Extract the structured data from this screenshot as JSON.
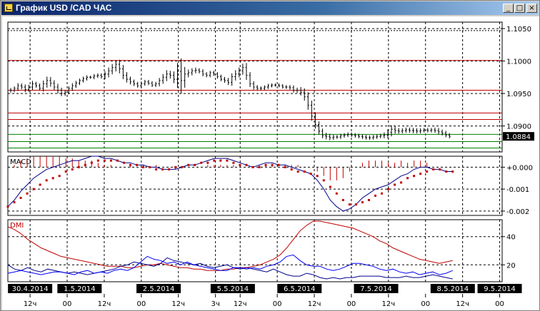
{
  "window": {
    "title": "График USD /CAD  ЧАС",
    "app_icon": "chart-app-icon",
    "controls": {
      "minimize": "_",
      "maximize": "□",
      "close": "×"
    }
  },
  "colors": {
    "price_bar": "#000000",
    "resistance_line": "#c00000",
    "support_line": "#008000",
    "macd_line": "#00008b",
    "macd_signal": "#c00000",
    "macd_hist": "#c00000",
    "dmi_adx": "#c00000",
    "dmi_plus": "#00008b",
    "dmi_minus": "#0000ff",
    "last_price_bg": "#000000",
    "last_price_fg": "#ffffff"
  },
  "chart_data": [
    {
      "type": "ohlc",
      "title": "",
      "ylim": [
        1.086,
        1.106
      ],
      "y_ticks": [
        "1.1050",
        "1.1000",
        "1.0950",
        "1.0900"
      ],
      "y_tick_values": [
        1.105,
        1.1,
        1.095,
        1.09
      ],
      "last_price": "1.0884",
      "last_price_value": 1.0884,
      "horizontal_lines": [
        {
          "value": 1.1047,
          "style": "dotted",
          "color": "black"
        },
        {
          "value": 1.1001,
          "style": "solid",
          "color": "red"
        },
        {
          "value": 1.0955,
          "style": "solid",
          "color": "red"
        },
        {
          "value": 1.092,
          "style": "solid",
          "color": "red"
        },
        {
          "value": 1.091,
          "style": "solid",
          "color": "red"
        },
        {
          "value": 1.0887,
          "style": "solid",
          "color": "green"
        },
        {
          "value": 1.0876,
          "style": "solid",
          "color": "green"
        },
        {
          "value": 1.0866,
          "style": "solid",
          "color": "green"
        }
      ],
      "close": [
        1.0955,
        1.0958,
        1.0962,
        1.096,
        1.0956,
        1.096,
        1.0965,
        1.0962,
        1.0958,
        1.0965,
        1.097,
        1.0966,
        1.096,
        1.0955,
        1.095,
        1.0952,
        1.0958,
        1.0962,
        1.0966,
        1.097,
        1.0973,
        1.0975,
        1.0975,
        1.0977,
        1.0978,
        1.0976,
        1.098,
        1.0985,
        1.099,
        1.0995,
        1.0988,
        1.0978,
        1.0972,
        1.0968,
        1.0965,
        1.0962,
        1.0965,
        1.0968,
        1.0966,
        1.0963,
        1.0965,
        1.097,
        1.0975,
        1.098,
        1.0978,
        1.0972,
        1.0984,
        1.097,
        1.098,
        1.0982,
        1.0985,
        1.0986,
        1.0984,
        1.098,
        1.0978,
        1.0982,
        1.098,
        1.0976,
        1.0972,
        1.097,
        1.0967,
        1.0976,
        1.098,
        1.0985,
        1.099,
        1.0978,
        1.0965,
        1.096,
        1.0958,
        1.0958,
        1.096,
        1.0962,
        1.0963,
        1.0963,
        1.0962,
        1.096,
        1.096,
        1.0959,
        1.0955,
        1.0955,
        1.0952,
        1.0945,
        1.0932,
        1.0915,
        1.0902,
        1.0892,
        1.0885,
        1.0884,
        1.0882,
        1.0883,
        1.0883,
        1.0885,
        1.0886,
        1.0887,
        1.0886,
        1.0885,
        1.0884,
        1.0883,
        1.0882,
        1.0882,
        1.0883,
        1.0884,
        1.0885,
        1.0886,
        1.089,
        1.0895,
        1.0893,
        1.0892,
        1.0893,
        1.0894,
        1.0893,
        1.0893,
        1.0892,
        1.0893,
        1.0894,
        1.0893,
        1.0894,
        1.0893,
        1.0891,
        1.0889,
        1.0886,
        1.0884
      ],
      "range": [
        0.0007,
        0.0006,
        0.0008,
        0.0007,
        0.0008,
        0.0007,
        0.0009,
        0.0006,
        0.0007,
        0.001,
        0.0012,
        0.0011,
        0.0009,
        0.001,
        0.0008,
        0.0007,
        0.0006,
        0.0008,
        0.0007,
        0.0006,
        0.0006,
        0.0006,
        0.0005,
        0.0006,
        0.0006,
        0.0006,
        0.0008,
        0.001,
        0.0011,
        0.0012,
        0.0014,
        0.0012,
        0.001,
        0.0008,
        0.0007,
        0.0006,
        0.0007,
        0.0006,
        0.0006,
        0.0006,
        0.0006,
        0.0008,
        0.001,
        0.0012,
        0.001,
        0.0012,
        0.0026,
        0.004,
        0.0022,
        0.001,
        0.0008,
        0.0008,
        0.0006,
        0.0007,
        0.0006,
        0.0006,
        0.0006,
        0.0006,
        0.0006,
        0.0007,
        0.0008,
        0.001,
        0.0012,
        0.001,
        0.0012,
        0.0014,
        0.001,
        0.0008,
        0.0006,
        0.0006,
        0.0005,
        0.0006,
        0.0005,
        0.0005,
        0.0005,
        0.0005,
        0.0006,
        0.0006,
        0.0007,
        0.0008,
        0.001,
        0.0012,
        0.0014,
        0.0014,
        0.0012,
        0.001,
        0.0008,
        0.0009,
        0.0008,
        0.0007,
        0.0006,
        0.0006,
        0.0006,
        0.0006,
        0.0006,
        0.0006,
        0.0006,
        0.0006,
        0.0006,
        0.0007,
        0.0006,
        0.0006,
        0.0006,
        0.0008,
        0.001,
        0.0012,
        0.001,
        0.0008,
        0.0007,
        0.0007,
        0.0007,
        0.0008,
        0.0007,
        0.0007,
        0.0006,
        0.0006,
        0.0006,
        0.0007,
        0.0008,
        0.0007,
        0.0007,
        0.0006
      ]
    },
    {
      "type": "line",
      "title": "MACD",
      "ylim": [
        -0.0022,
        0.0005
      ],
      "y_ticks": [
        "+0.000",
        "-0.001",
        "-0.002"
      ],
      "y_tick_values": [
        0.0,
        -0.001,
        -0.002
      ],
      "macd": [
        -0.0018,
        -0.0015,
        -0.0011,
        -0.0008,
        -0.0005,
        -0.0003,
        -0.0001,
        0.0,
        0.0001,
        0.0002,
        0.0003,
        0.0003,
        0.0004,
        0.0005,
        0.0005,
        0.0004,
        0.0004,
        0.0003,
        0.0002,
        0.0002,
        0.0001,
        0.0001,
        0.0,
        0.0,
        -0.0001,
        -0.0001,
        -0.0001,
        0.0,
        0.0001,
        0.0001,
        0.0002,
        0.0003,
        0.0004,
        0.0004,
        0.0004,
        0.0003,
        0.0002,
        0.0001,
        0.0,
        0.0001,
        0.0002,
        0.0002,
        0.0001,
        0.0001,
        0.0,
        -0.0001,
        -0.0002,
        -0.0003,
        -0.0006,
        -0.001,
        -0.0015,
        -0.0018,
        -0.002,
        -0.0019,
        -0.0017,
        -0.0014,
        -0.0012,
        -0.001,
        -0.0009,
        -0.0008,
        -0.0006,
        -0.0004,
        -0.0003,
        -0.0001,
        0.0,
        0.0,
        -0.0001,
        -0.0001,
        -0.0002,
        -0.0002
      ],
      "signal": [
        -0.0018,
        -0.0016,
        -0.0014,
        -0.0012,
        -0.001,
        -0.0008,
        -0.0006,
        -0.0005,
        -0.0004,
        -0.0002,
        -0.0001,
        0.0,
        0.0001,
        0.0002,
        0.0003,
        0.0003,
        0.0003,
        0.0003,
        0.0002,
        0.0001,
        0.0001,
        0.0,
        0.0,
        -0.0001,
        -0.0001,
        -0.0001,
        0.0,
        0.0,
        0.0001,
        0.0001,
        0.0002,
        0.0002,
        0.0003,
        0.0003,
        0.0003,
        0.0002,
        0.0001,
        0.0001,
        0.0,
        0.0,
        0.0001,
        0.0001,
        0.0001,
        0.0,
        -0.0001,
        -0.0002,
        -0.0002,
        -0.0003,
        -0.0004,
        -0.0006,
        -0.0009,
        -0.0012,
        -0.0015,
        -0.0017,
        -0.0017,
        -0.0016,
        -0.0015,
        -0.0013,
        -0.0012,
        -0.001,
        -0.0008,
        -0.0007,
        -0.0005,
        -0.0004,
        -0.0003,
        -0.0002,
        -0.0001,
        -0.0001,
        -0.0002,
        -0.0002
      ],
      "histogram": [
        0.0,
        0.0001,
        0.0003,
        0.0004,
        0.0005,
        0.0005,
        0.0005,
        0.0005,
        0.0005,
        0.0004,
        0.0004,
        0.0003,
        0.0003,
        0.0003,
        0.0002,
        0.0001,
        0.0001,
        0.0,
        0.0,
        0.0001,
        0.0,
        0.0001,
        0.0,
        0.0001,
        0.0,
        0.0,
        -0.0001,
        0.0,
        0.0,
        0.0,
        0.0,
        0.0001,
        0.0001,
        0.0001,
        0.0001,
        0.0001,
        0.0001,
        0.0,
        0.0,
        0.0001,
        0.0001,
        0.0001,
        0.0,
        0.0001,
        0.0001,
        0.0001,
        0.0,
        0.0,
        -0.0002,
        -0.0004,
        -0.0006,
        -0.0006,
        -0.0005,
        -0.0002,
        0.0,
        0.0002,
        0.0003,
        0.0003,
        0.0003,
        0.0002,
        0.0002,
        0.0003,
        0.0002,
        0.0003,
        0.0003,
        0.0002,
        0.0,
        0.0,
        0.0,
        0.0
      ]
    },
    {
      "type": "line",
      "title": "DMI",
      "ylim": [
        8,
        52
      ],
      "y_ticks": [
        "40",
        "20"
      ],
      "y_tick_values": [
        40,
        20
      ],
      "adx": [
        47,
        45,
        42,
        38,
        35,
        32,
        30,
        28,
        26,
        25,
        24,
        23,
        22,
        21,
        20,
        19,
        19,
        19,
        18,
        18,
        19,
        20,
        20,
        21,
        20,
        19,
        18,
        18,
        17,
        17,
        16,
        16,
        16,
        17,
        17,
        18,
        18,
        19,
        20,
        22,
        24,
        27,
        32,
        38,
        44,
        48,
        51,
        51,
        50,
        49,
        48,
        47,
        46,
        44,
        42,
        40,
        37,
        35,
        32,
        30,
        28,
        26,
        24,
        23,
        22,
        21,
        22,
        23
      ],
      "di_plus": [
        20,
        17,
        16,
        18,
        16,
        15,
        17,
        16,
        15,
        14,
        15,
        14,
        13,
        14,
        15,
        16,
        17,
        19,
        20,
        22,
        21,
        20,
        19,
        21,
        25,
        23,
        22,
        21,
        20,
        21,
        19,
        18,
        19,
        20,
        18,
        17,
        18,
        17,
        16,
        15,
        17,
        15,
        13,
        12,
        12,
        14,
        13,
        11,
        10,
        11,
        10,
        11,
        11,
        12,
        12,
        12,
        12,
        11,
        11,
        11,
        12,
        11,
        11,
        12,
        13,
        12,
        11,
        10
      ],
      "di_minus": [
        14,
        15,
        16,
        15,
        14,
        13,
        14,
        15,
        15,
        14,
        13,
        15,
        16,
        14,
        15,
        14,
        16,
        17,
        16,
        18,
        22,
        26,
        24,
        23,
        21,
        22,
        20,
        22,
        20,
        19,
        18,
        17,
        16,
        16,
        18,
        18,
        17,
        18,
        17,
        19,
        20,
        22,
        26,
        27,
        23,
        20,
        19,
        19,
        17,
        16,
        17,
        19,
        21,
        21,
        20,
        19,
        17,
        16,
        17,
        15,
        14,
        15,
        13,
        14,
        15,
        13,
        14,
        16
      ]
    }
  ],
  "time_axis": {
    "dates": [
      "30.4.2014",
      "1.5.2014",
      "2.5.2014",
      "5.5.2014",
      "6.5.2014",
      "7.5.2014",
      "8.5.2014",
      "9.5.2014"
    ],
    "date_positions_frac": [
      0.045,
      0.145,
      0.305,
      0.455,
      0.59,
      0.745,
      0.9,
      0.995
    ],
    "hours": [
      "12ч",
      "00",
      "12ч",
      "00",
      "12ч",
      "3ч",
      "12ч",
      "00",
      "12ч",
      "00",
      "12ч",
      "00",
      "12ч",
      "00"
    ],
    "hour_positions_frac": [
      0.045,
      0.12,
      0.195,
      0.27,
      0.345,
      0.42,
      0.47,
      0.545,
      0.62,
      0.695,
      0.77,
      0.845,
      0.92,
      0.995
    ]
  }
}
